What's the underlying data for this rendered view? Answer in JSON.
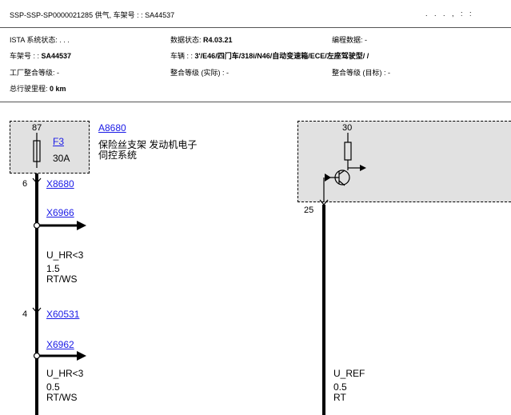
{
  "header": {
    "title": "SSP-SSP-SP0000021285 供气, 车架号 : : SA44537",
    "right_marks": ". . . , : :",
    "ista_label": "ISTA 系统状态:",
    "ista_value": ". . .",
    "data_status_label": "数据状态:",
    "data_status_value": "R4.03.21",
    "program_data_label": "编程数据: -",
    "vin_label": "车架号 : :",
    "vin_value": "SA44537",
    "vehicle_label": "车辆 : :",
    "vehicle_value": "3'/E46/四门车/318i/N46/自动变速箱/ECE/左座驾驶型/ /",
    "factory_level": "工厂整合等级: -",
    "actual_level": "整合等级 (实际) : -",
    "target_level": "整合等级 (目标) : -",
    "mileage_label": "总行驶里程:",
    "mileage_value": "0 km"
  },
  "diagram": {
    "fuse_pin_top": "87",
    "fuse_link": "F3",
    "fuse_amp": "30A",
    "component_link": "A8680",
    "component_desc_line1": "保险丝支架 发动机电子",
    "component_desc_line2": "伺控系统",
    "pin_6": "6",
    "conn_1": "X8680",
    "conn_2": "X6966",
    "wire1_signal": "U_HR<3",
    "wire1_size": "1.5",
    "wire1_color": "RT/WS",
    "pin_4": "4",
    "conn_3": "X60531",
    "conn_4": "X6962",
    "wire2_signal": "U_HR<3",
    "wire2_size": "0.5",
    "wire2_color": "RT/WS",
    "relay_pin_top": "30",
    "relay_pin_bottom": "25",
    "wire3_signal": "U_REF",
    "wire3_size": "0.5",
    "wire3_color": "RT"
  }
}
